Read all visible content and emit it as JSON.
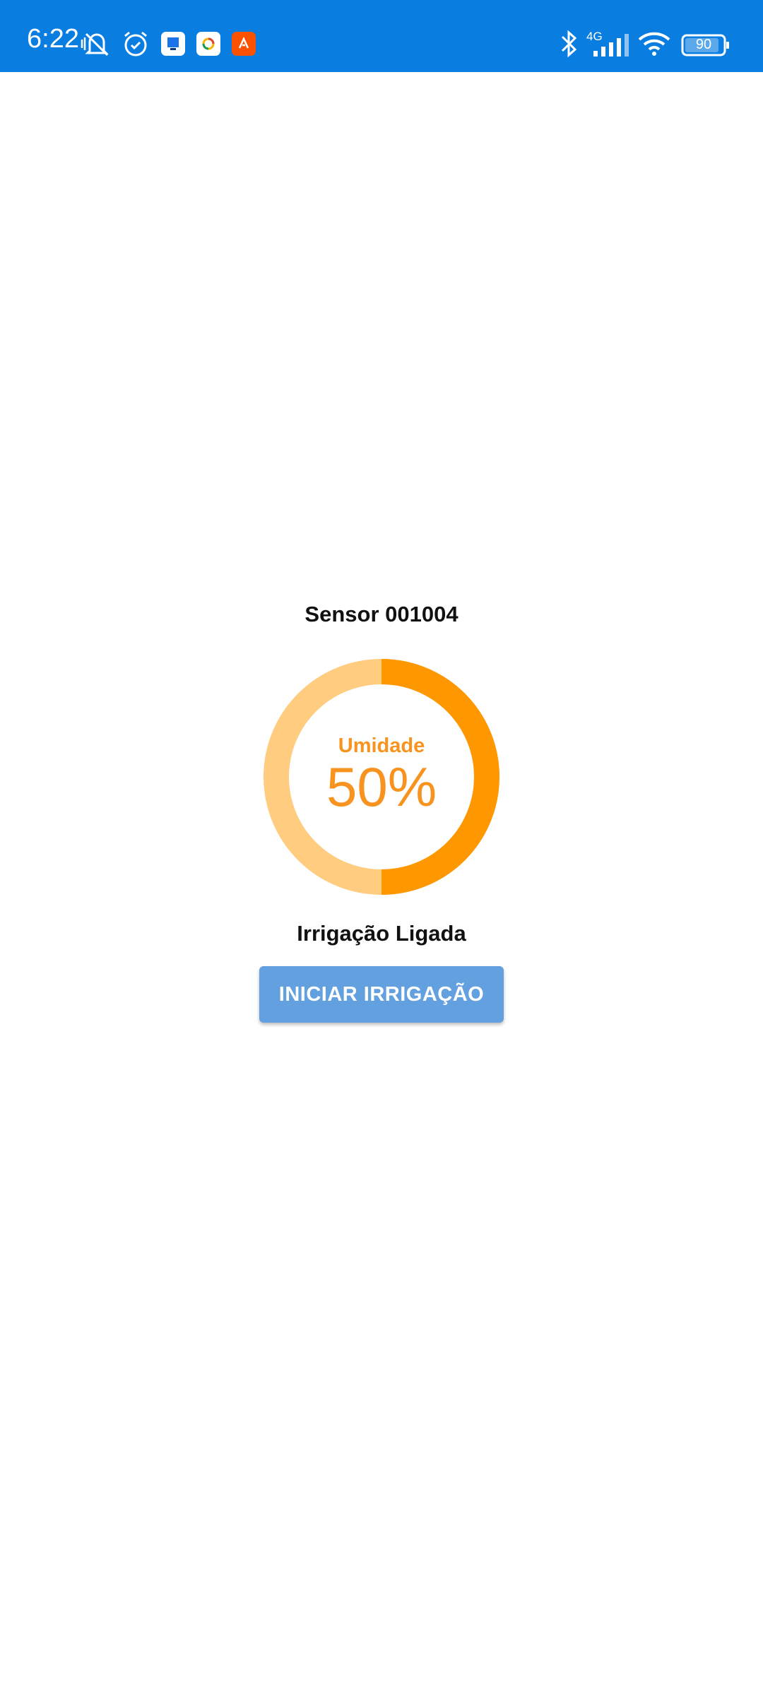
{
  "status_bar": {
    "time": "6:22",
    "network_label": "4G",
    "battery_level": "90",
    "icons": [
      "vibrate-muted-icon",
      "alarm-icon",
      "app-icon-blue",
      "app-icon-ring",
      "app-icon-strava",
      "bluetooth-icon",
      "signal-icon",
      "wifi-icon",
      "battery-icon"
    ]
  },
  "sensor": {
    "title": "Sensor 001004",
    "gauge_label": "Umidade",
    "gauge_value_text": "50%",
    "gauge_fraction": 0.5,
    "status_text": "Irrigação Ligada"
  },
  "actions": {
    "start_button": "INICIAR IRRIGAÇÃO"
  },
  "colors": {
    "status_bar": "#0a7ee0",
    "gauge_fill": "#ff9800",
    "gauge_track": "#ffcc80",
    "gauge_text": "#f7931e",
    "button": "#62a0df"
  }
}
